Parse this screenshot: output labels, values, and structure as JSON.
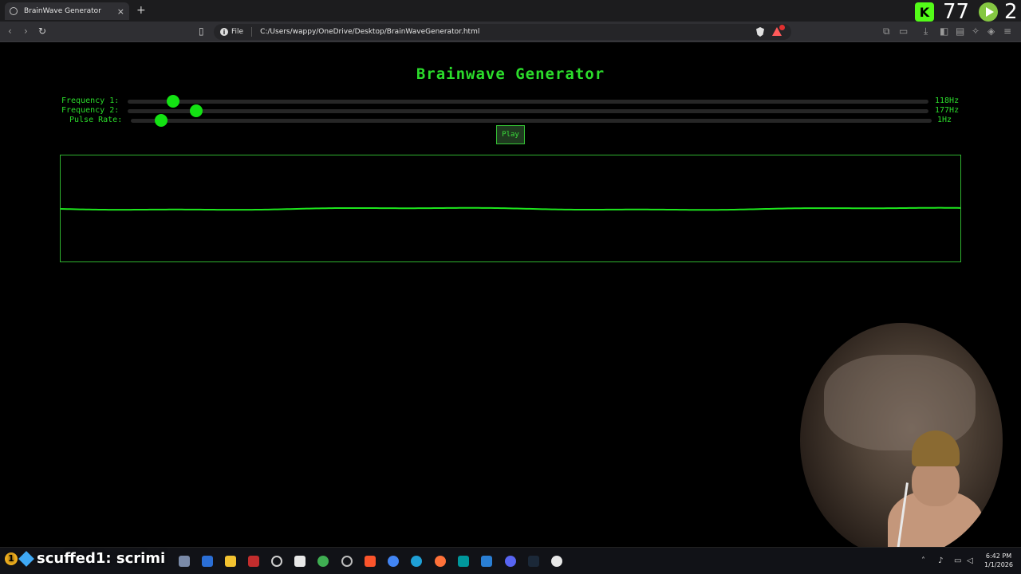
{
  "browser": {
    "tab_title": "BrainWave Generator",
    "new_tab": "+",
    "close": "×",
    "url_scheme": "File",
    "url_info": "i",
    "url_path": "C:/Users/wappy/OneDrive/Desktop/BrainWaveGenerator.html"
  },
  "overlay": {
    "kick_logo": "K",
    "kick_count": "77",
    "rumble_count": "2"
  },
  "app": {
    "title": "Brainwave Generator",
    "sliders": [
      {
        "label": "Frequency 1:",
        "value_text": "118Hz",
        "level": 0.057
      },
      {
        "label": "Frequency 2:",
        "value_text": "177Hz",
        "level": 0.086
      },
      {
        "label": "Pulse Rate:",
        "value_text": "1Hz",
        "level": 0.038
      }
    ],
    "play_label": "Play"
  },
  "taskbar": {
    "scuffed_badge": "1",
    "scuffed_text": "scuffed1: scrimi",
    "clock_time": "6:42 PM",
    "clock_date": "1/1/2026"
  },
  "colors": {
    "accent": "#2bdc2b",
    "wave": "#1ee61e",
    "background": "#000000"
  }
}
